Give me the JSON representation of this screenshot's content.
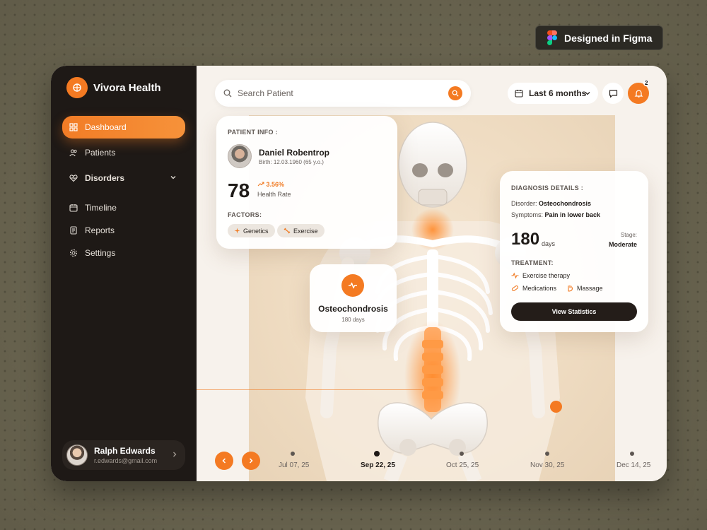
{
  "badge": {
    "label": "Designed in Figma",
    "icon": "figma-logo"
  },
  "sidebar": {
    "brand": "Vivora Health",
    "items": [
      {
        "label": "Dashboard",
        "icon": "dashboard-icon",
        "active": true
      },
      {
        "label": "Patients",
        "icon": "users-icon"
      },
      {
        "label": "Disorders",
        "icon": "heart-pulse-icon",
        "expandable": true
      },
      {
        "label": "Timeline",
        "icon": "calendar-icon"
      },
      {
        "label": "Reports",
        "icon": "report-icon"
      },
      {
        "label": "Settings",
        "icon": "gear-icon"
      }
    ],
    "user": {
      "name": "Ralph Edwards",
      "email": "r.edwards@gmail.com"
    }
  },
  "header": {
    "search_placeholder": "Search Patient",
    "range": "Last 6 months",
    "notification_count": "2"
  },
  "patient": {
    "heading": "PATIENT INFO :",
    "name": "Daniel Robentrop",
    "birth": "Birth: 12.03.1960 (65 y.o.)",
    "health_rate": "78",
    "delta": "3.56%",
    "health_rate_label": "Health Rate",
    "factors_heading": "FACTORS:",
    "factors": [
      "Genetics",
      "Exercise"
    ]
  },
  "highlight": {
    "title": "Osteochondrosis",
    "duration": "180 days"
  },
  "diagnosis": {
    "heading": "DIAGNOSIS DETAILS :",
    "disorder_label": "Disorder:",
    "disorder_value": "Osteochondrosis",
    "symptoms_label": "Symptoms:",
    "symptoms_value": "Pain in lower back",
    "days": "180",
    "days_unit": "days",
    "stage_label": "Stage:",
    "stage_value": "Moderate",
    "treatment_heading": "TREATMENT:",
    "treatments": [
      "Exercise therapy",
      "Medications",
      "Massage"
    ],
    "button": "View Statistics"
  },
  "timeline": {
    "dates": [
      "Jul 07, 25",
      "Sep 22, 25",
      "Oct 25, 25",
      "Nov 30, 25",
      "Dec 14, 25"
    ],
    "active_index": 1
  },
  "colors": {
    "accent": "#f47a22",
    "sidebar_bg": "#1e1916",
    "main_bg": "#f7f2ec"
  }
}
